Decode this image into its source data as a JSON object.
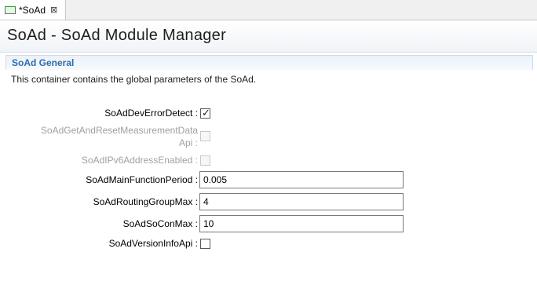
{
  "tab": {
    "label": "*SoAd",
    "close_glyph": "⊠"
  },
  "header": {
    "title": "SoAd - SoAd Module Manager"
  },
  "section": {
    "title": "SoAd General",
    "description": "This container contains the global parameters of the SoAd."
  },
  "fields": {
    "dev_error_detect": {
      "label": "SoAdDevErrorDetect :",
      "checked": true,
      "enabled": true
    },
    "get_reset_measurement": {
      "label_line1": "SoAdGetAndResetMeasurementData",
      "label_line2": "Api :",
      "checked": false,
      "enabled": false
    },
    "ipv6_enabled": {
      "label": "SoAdIPv6AddressEnabled :",
      "checked": false,
      "enabled": false
    },
    "main_function_period": {
      "label": "SoAdMainFunctionPeriod :",
      "value": "0.005"
    },
    "routing_group_max": {
      "label": "SoAdRoutingGroupMax :",
      "value": "4"
    },
    "so_con_max": {
      "label": "SoAdSoConMax :",
      "value": "10"
    },
    "version_info_api": {
      "label": "SoAdVersionInfoApi :",
      "checked": false,
      "enabled": true
    }
  },
  "icons": {
    "check_glyph": "✓"
  }
}
